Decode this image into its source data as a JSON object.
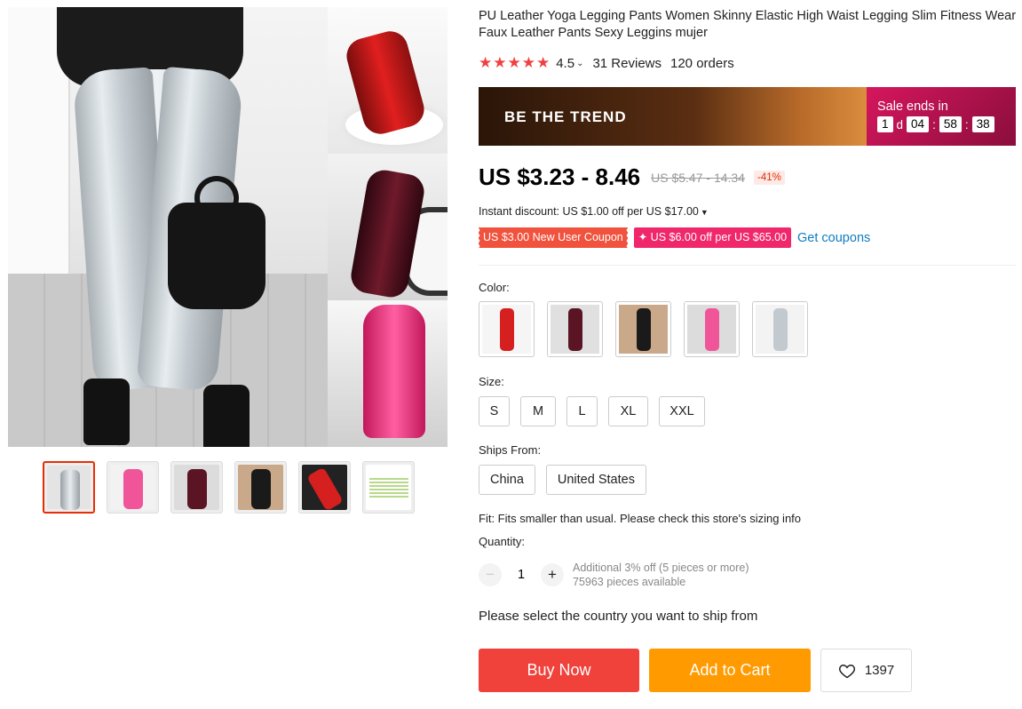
{
  "product": {
    "title": "PU Leather Yoga Legging Pants Women Skinny Elastic High Waist Legging Slim Fitness Wear Faux Leather Pants Sexy Leggins mujer",
    "stars": "★★★★★",
    "rating": "4.5",
    "reviews": "31 Reviews",
    "orders": "120 orders"
  },
  "banner": {
    "text": "BE THE TREND",
    "sale_label": "Sale ends in",
    "days": "1",
    "days_unit": "d",
    "hours": "04",
    "minutes": "58",
    "seconds": "38"
  },
  "pricing": {
    "price": "US $3.23 - 8.46",
    "old_price": "US $5.47 - 14.34",
    "discount": "-41%",
    "instant_discount": "Instant discount: US $1.00 off per US $17.00",
    "coupon_new_user": "US $3.00 New User Coupon",
    "coupon_store": "✦ US $6.00 off per US $65.00",
    "get_coupons": "Get coupons"
  },
  "options": {
    "color_label": "Color:",
    "colors": [
      {
        "name": "red",
        "hex": "#d61f1f"
      },
      {
        "name": "maroon",
        "hex": "#5b1424"
      },
      {
        "name": "black",
        "hex": "#1a1a1a"
      },
      {
        "name": "pink",
        "hex": "#f0559a"
      },
      {
        "name": "silver",
        "hex": "#c3cacf"
      }
    ],
    "size_label": "Size:",
    "sizes": [
      "S",
      "M",
      "L",
      "XL",
      "XXL"
    ],
    "ships_label": "Ships From:",
    "ships": [
      "China",
      "United States"
    ],
    "fit": "Fit: Fits smaller than usual. Please check this store's sizing info",
    "quantity_label": "Quantity:",
    "quantity": "1",
    "qty_minus": "−",
    "qty_plus": "+",
    "qty_note": "Additional 3% off (5 pieces or more)",
    "qty_available": "75963 pieces available",
    "ship_message": "Please select the country you want to ship from"
  },
  "actions": {
    "buy_now": "Buy Now",
    "add_to_cart": "Add to Cart",
    "wishlist_count": "1397"
  },
  "colors": {
    "accent_red": "#f0413b",
    "accent_orange": "#ff9a00",
    "link_blue": "#0e7dc1"
  }
}
